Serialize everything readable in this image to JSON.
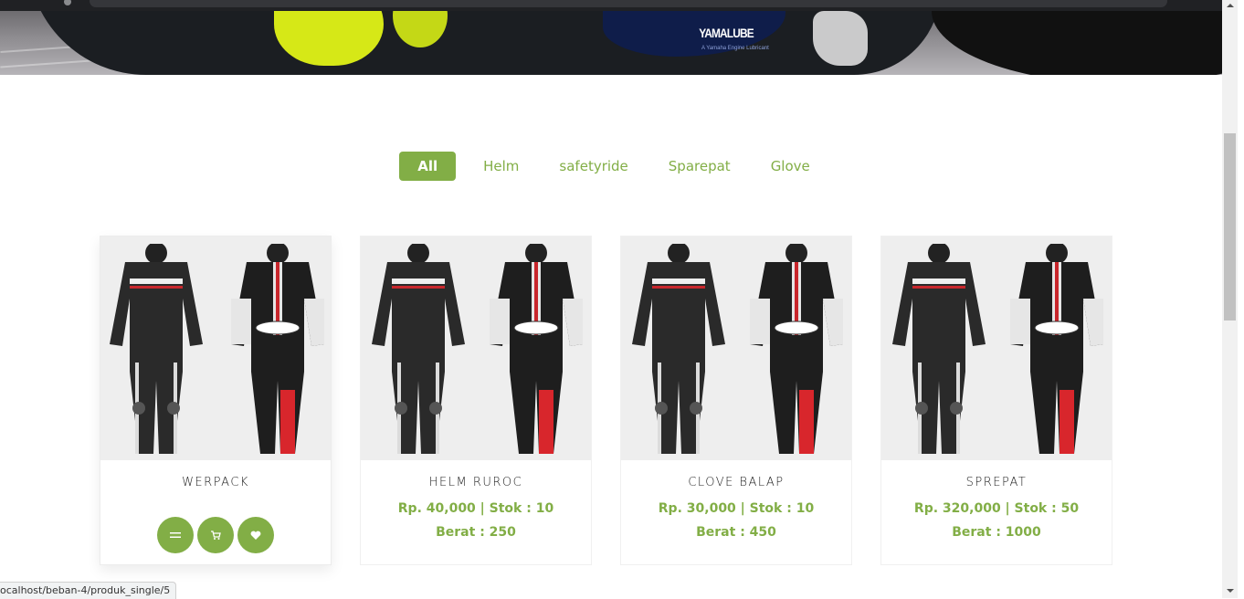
{
  "colors": {
    "accent": "#82ae46",
    "card_image_bg": "#eeeeee"
  },
  "hero": {
    "sponsor_text": "YAMALUBE",
    "sponsor_subtext": "A Yamaha Engine Lubricant"
  },
  "filters": [
    {
      "label": "All",
      "active": true
    },
    {
      "label": "Helm",
      "active": false
    },
    {
      "label": "safetyride",
      "active": false
    },
    {
      "label": "Sparepat",
      "active": false
    },
    {
      "label": "Glove",
      "active": false
    }
  ],
  "products": [
    {
      "name": "WERPACK",
      "price_line": "",
      "weight_line": "",
      "hovered": true,
      "actions": [
        {
          "icon": "menu-icon",
          "glyph": "≡"
        },
        {
          "icon": "cart-icon",
          "glyph": "🛒"
        },
        {
          "icon": "heart-icon",
          "glyph": "♥"
        }
      ]
    },
    {
      "name": "HELM RUROC",
      "price_line": "Rp. 40,000 | Stok : 10",
      "weight_line": "Berat : 250",
      "hovered": false
    },
    {
      "name": "CLOVE BALAP",
      "price_line": "Rp. 30,000 | Stok : 10",
      "weight_line": "Berat : 450",
      "hovered": false
    },
    {
      "name": "SPREPAT",
      "price_line": "Rp. 320,000 | Stok : 50",
      "weight_line": "Berat : 1000",
      "hovered": false
    }
  ],
  "status_bar": {
    "url": "ocalhost/beban-4/produk_single/5"
  }
}
